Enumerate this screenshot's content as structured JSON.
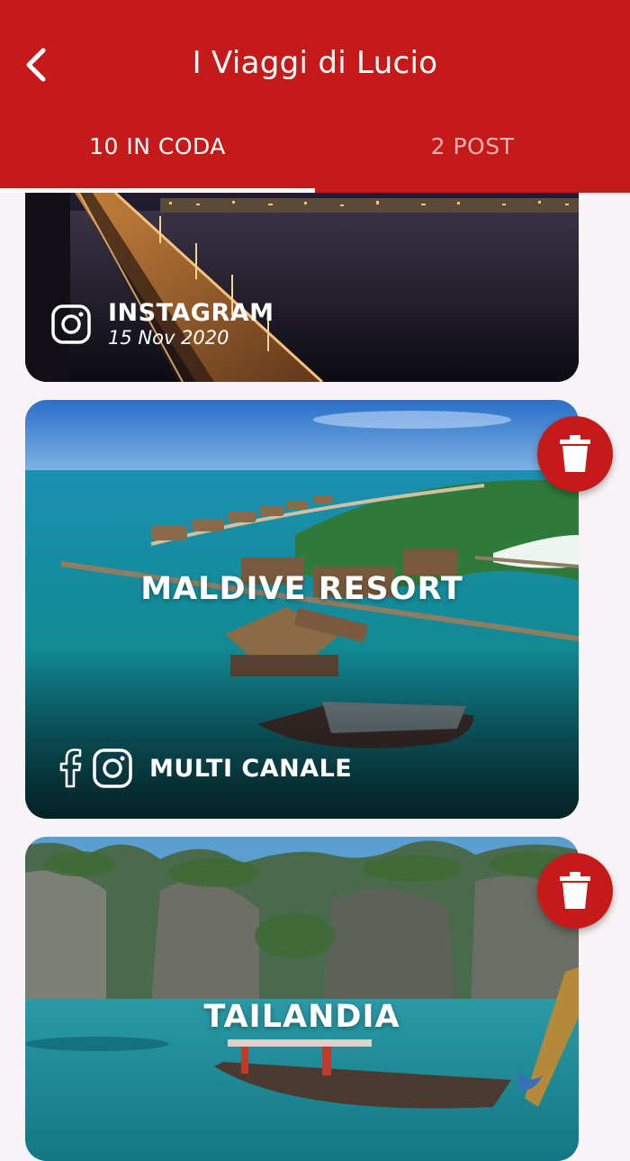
{
  "header": {
    "title": "I Viaggi di Lucio",
    "back_icon": "chevron-left-icon"
  },
  "tabs": [
    {
      "label": "10 IN CODA",
      "selected": true
    },
    {
      "label": "2 POST",
      "selected": false
    }
  ],
  "colors": {
    "primary": "#c61a1a",
    "tab_inactive": "#f3b1b1",
    "background": "#f7f3f6"
  },
  "posts": [
    {
      "channel_label": "INSTAGRAM",
      "date": "15 Nov 2020",
      "channel_icons": [
        "instagram-icon"
      ],
      "image": "night-bridge-city"
    },
    {
      "title": "MALDIVE RESORT",
      "channel_label": "MULTI CANALE",
      "channel_icons": [
        "facebook-icon",
        "instagram-icon"
      ],
      "image": "maldives-overwater-resort",
      "action_icon": "trash-icon"
    },
    {
      "title": "TAILANDIA",
      "image": "thailand-bay-longtail-boat",
      "action_icon": "trash-icon"
    }
  ]
}
